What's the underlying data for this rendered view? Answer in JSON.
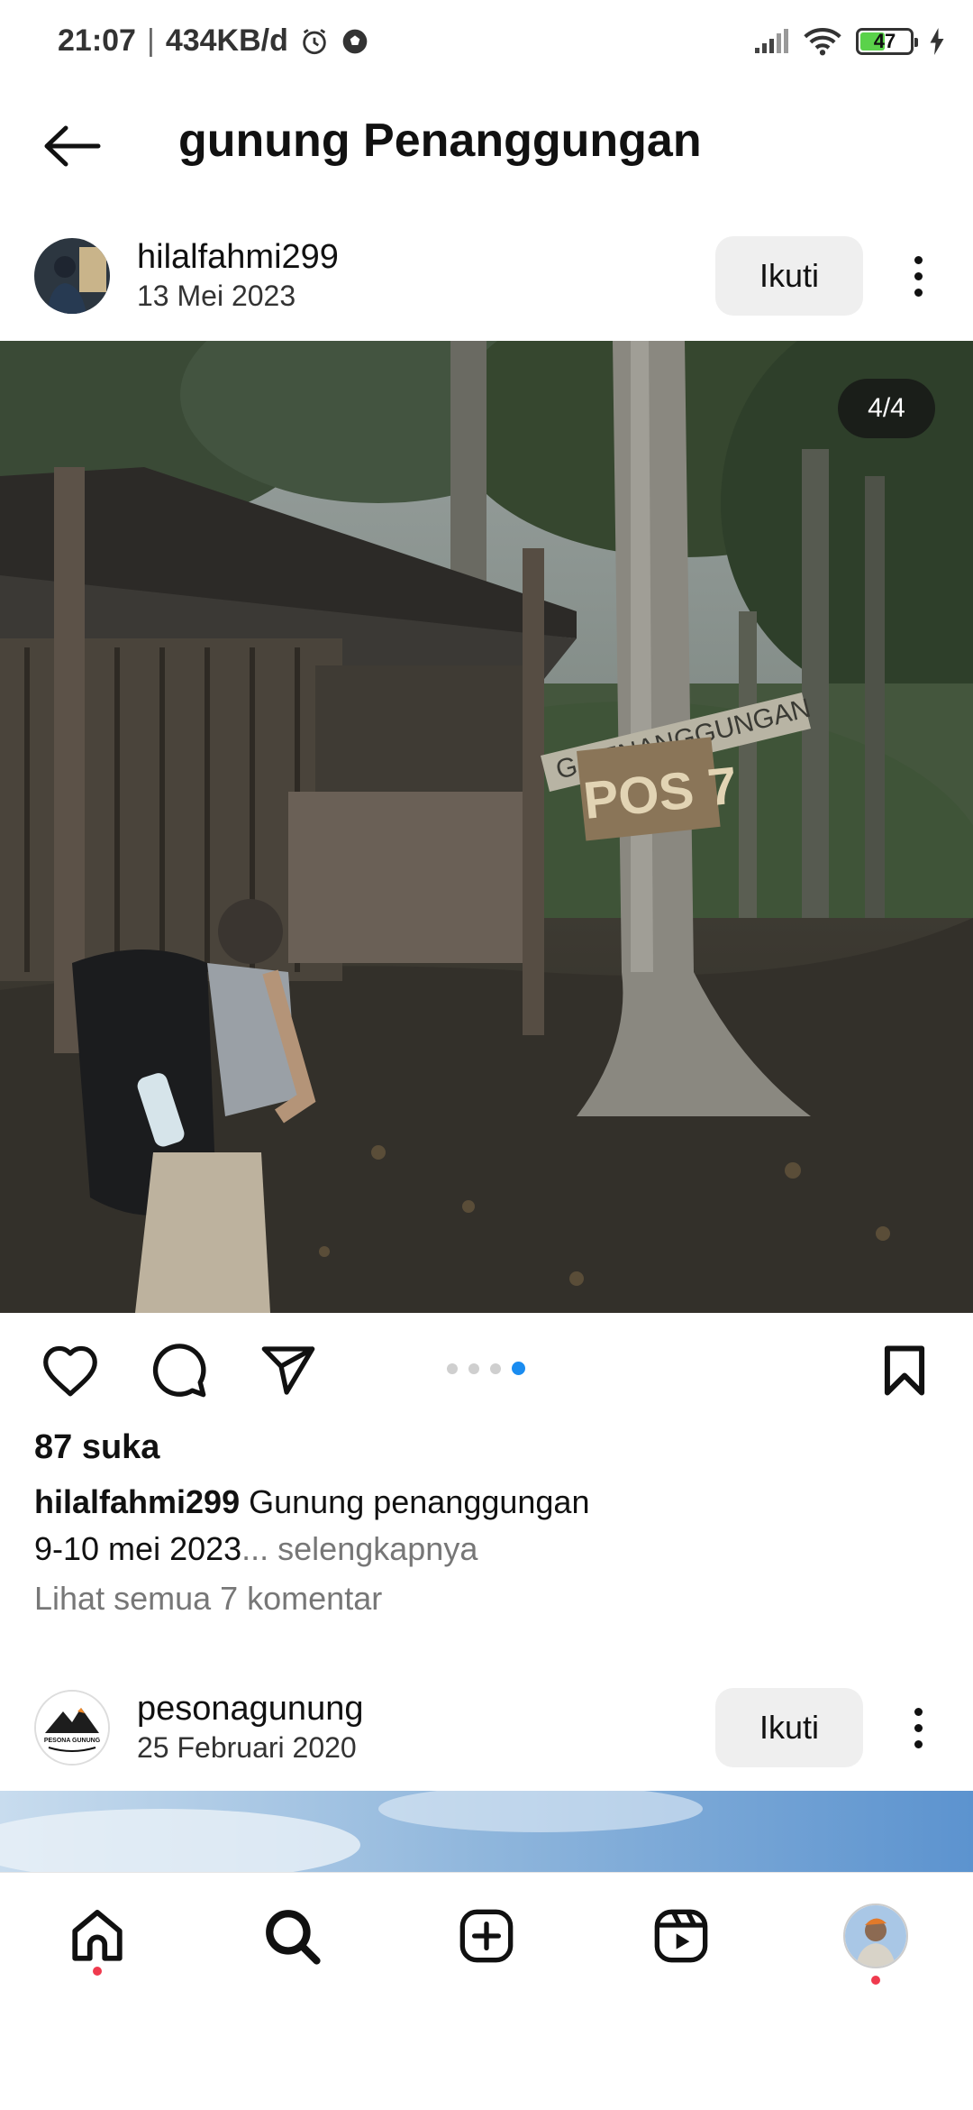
{
  "status_bar": {
    "time": "21:07",
    "network_speed": "434KB/d",
    "battery": "47"
  },
  "header": {
    "title": "gunung Penanggungan"
  },
  "post1": {
    "username": "hilalfahmi299",
    "date": "13 Mei 2023",
    "follow_label": "Ikuti",
    "counter": "4/4",
    "carousel_total": 4,
    "carousel_active_index": 4,
    "sign_text_1": "G.PENANGGUNGAN",
    "sign_text_2": "POS 7",
    "likes": "87 suka",
    "caption_user": "hilalfahmi299",
    "caption_line1": "Gunung penanggungan",
    "caption_line2": "9-10 mei 2023",
    "caption_more": "... selengkapnya",
    "comments_link": "Lihat semua 7 komentar"
  },
  "post2": {
    "username": "pesonagunung",
    "date": "25 Februari 2020",
    "follow_label": "Ikuti",
    "avatar_text": "PESONA GUNUNG"
  },
  "bottom_nav": {
    "items": [
      "home-icon",
      "search-icon",
      "create-icon",
      "reels-icon",
      "profile-avatar"
    ]
  },
  "colors": {
    "accent_blue": "#1a8cf0",
    "notification_red": "#ef3a4e",
    "follow_bg": "#efefef"
  }
}
